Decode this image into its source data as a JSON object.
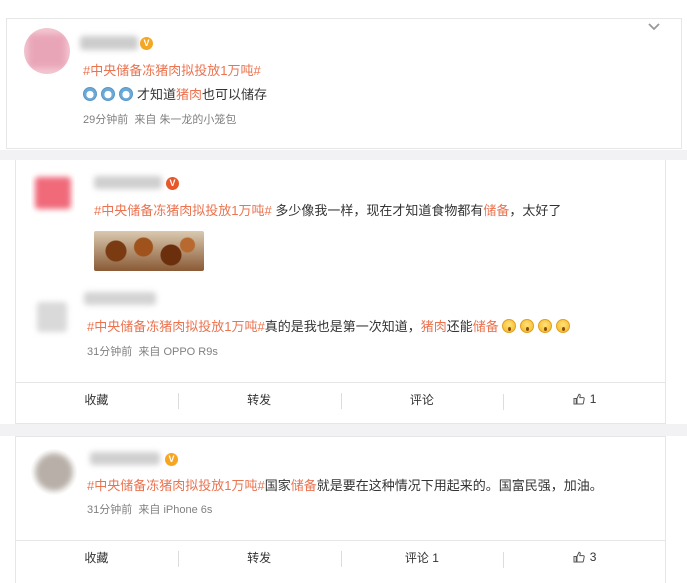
{
  "post1": {
    "topic": "#中央储备冻猪肉拟投放1万吨#",
    "vip_badge": "V",
    "body_pre": "才知道",
    "body_keyword": "猪肉",
    "body_post": "也可以储存",
    "emojis": [
      "dog-face-emoji",
      "dog-face-emoji",
      "dog-face-emoji"
    ],
    "time": "29分钟前",
    "source_prefix": "来自",
    "source": "朱一龙的小笼包"
  },
  "post2": {
    "topic": "#中央储备冻猪肉拟投放1万吨#",
    "vip_badge": "V",
    "body_pre": " 多少像我一样，现在才知道食物都有",
    "body_keyword": "储备",
    "body_post": "，太好了",
    "image": "food-thumbnail"
  },
  "post3": {
    "topic": "#中央储备冻猪肉拟投放1万吨#",
    "body_pre": "真的是我也是第一次知道，",
    "keyword1": "猪肉",
    "body_mid": "还能",
    "keyword2": "储备",
    "emojis": [
      "surprised-face-emoji",
      "surprised-face-emoji",
      "surprised-face-emoji",
      "surprised-face-emoji"
    ],
    "time": "31分钟前",
    "source_prefix": "来自",
    "source": "OPPO R9s"
  },
  "actions1": {
    "collect": "收藏",
    "repost": "转发",
    "comment": "评论",
    "like_count": "1"
  },
  "post4": {
    "topic": "#中央储备冻猪肉拟投放1万吨#",
    "vip_badge": "V",
    "body_pre": "国家",
    "body_keyword": "储备",
    "body_post": "就是要在这种情况下用起来的。国富民强，加油。",
    "time": "31分钟前",
    "source_prefix": "来自",
    "source": "iPhone 6s"
  },
  "actions2": {
    "collect": "收藏",
    "repost": "转发",
    "comment": "评论 1",
    "like_count": "3"
  },
  "colors": {
    "topic": "#eb7350",
    "meta": "#808080",
    "vip": "#f5a623"
  }
}
